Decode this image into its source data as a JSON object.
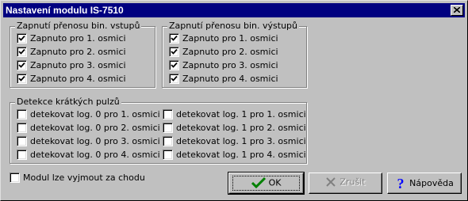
{
  "window": {
    "title": "Nastavení modulu IS-7510"
  },
  "inputs_group": {
    "title": "Zapnutí přenosu bin. vstupů",
    "items": [
      {
        "label": "Zapnuto pro 1. osmici",
        "checked": true
      },
      {
        "label": "Zapnuto pro 2. osmici",
        "checked": true
      },
      {
        "label": "Zapnuto pro 3. osmici",
        "checked": true
      },
      {
        "label": "Zapnuto pro 4. osmici",
        "checked": true
      }
    ]
  },
  "outputs_group": {
    "title": "Zapnutí přenosu bin. výstupů",
    "items": [
      {
        "label": "Zapnuto pro 1. osmici",
        "checked": true
      },
      {
        "label": "Zapnuto pro 2. osmici",
        "checked": true
      },
      {
        "label": "Zapnuto pro 3. osmici",
        "checked": true
      },
      {
        "label": "Zapnuto pro 4. osmici",
        "checked": true
      }
    ]
  },
  "pulses_group": {
    "title": "Detekce krátkých pulzů",
    "log0": [
      {
        "label": "detekovat log. 0 pro 1. osmici",
        "checked": false
      },
      {
        "label": "detekovat log. 0 pro 2. osmici",
        "checked": false
      },
      {
        "label": "detekovat log. 0 pro 3. osmici",
        "checked": false
      },
      {
        "label": "detekovat log. 0 pro 4. osmici",
        "checked": false
      }
    ],
    "log1": [
      {
        "label": "detekovat log. 1 pro 1. osmici",
        "checked": false
      },
      {
        "label": "detekovat log. 1 pro 2. osmici",
        "checked": false
      },
      {
        "label": "detekovat log. 1 pro 3. osmici",
        "checked": false
      },
      {
        "label": "detekovat log. 1 pro 4. osmici",
        "checked": false
      }
    ]
  },
  "hot_swap": {
    "label": "Modul lze vyjmout za chodu",
    "checked": false
  },
  "buttons": {
    "ok": {
      "label": "OK",
      "icon": "checkmark-icon"
    },
    "cancel": {
      "label": "Zrušit",
      "icon": "cross-icon",
      "enabled": false
    },
    "help": {
      "label": "Nápověda",
      "icon": "question-icon"
    }
  },
  "colors": {
    "title_bar": "#000080",
    "face": "#c0c0c0",
    "ok_check": "#008000",
    "help_icon": "#0000ff"
  }
}
